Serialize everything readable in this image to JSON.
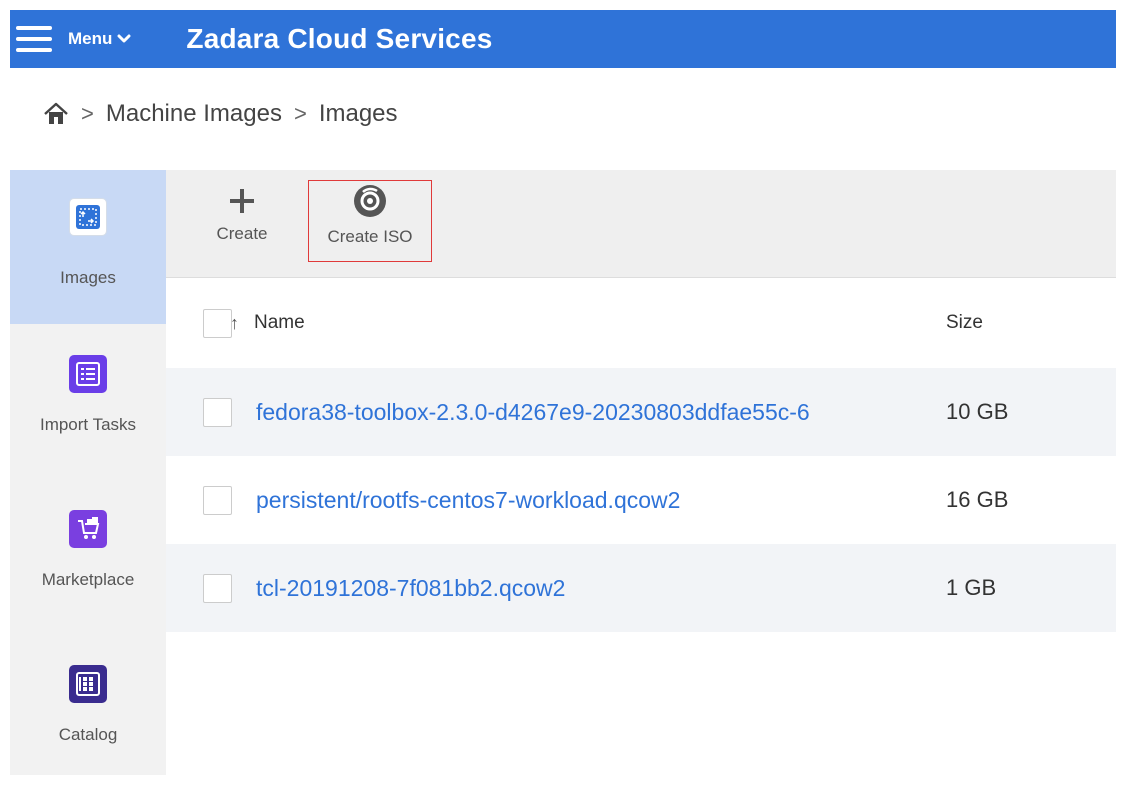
{
  "header": {
    "menu_label": "Menu",
    "brand": "Zadara Cloud Services",
    "accent_color": "#2f73d8"
  },
  "breadcrumb": {
    "home_icon": "home-icon",
    "items": [
      "Machine Images",
      "Images"
    ]
  },
  "sidebar": {
    "items": [
      {
        "label": "Images",
        "icon": "images-icon",
        "color": "#2f73d8",
        "active": true
      },
      {
        "label": "Import Tasks",
        "icon": "list-icon",
        "color": "#6a3ee8",
        "active": false
      },
      {
        "label": "Marketplace",
        "icon": "marketplace-icon",
        "color": "#7a3fe0",
        "active": false
      },
      {
        "label": "Catalog",
        "icon": "catalog-icon",
        "color": "#3a2c8f",
        "active": false
      }
    ]
  },
  "toolbar": {
    "create_label": "Create",
    "create_iso_label": "Create ISO"
  },
  "table": {
    "columns": {
      "name": "Name",
      "size": "Size"
    },
    "rows": [
      {
        "name": "fedora38-toolbox-2.3.0-d4267e9-20230803ddfae55c-6",
        "size": "10 GB"
      },
      {
        "name": "persistent/rootfs-centos7-workload.qcow2",
        "size": "16 GB"
      },
      {
        "name": "tcl-20191208-7f081bb2.qcow2",
        "size": "1 GB"
      }
    ]
  }
}
